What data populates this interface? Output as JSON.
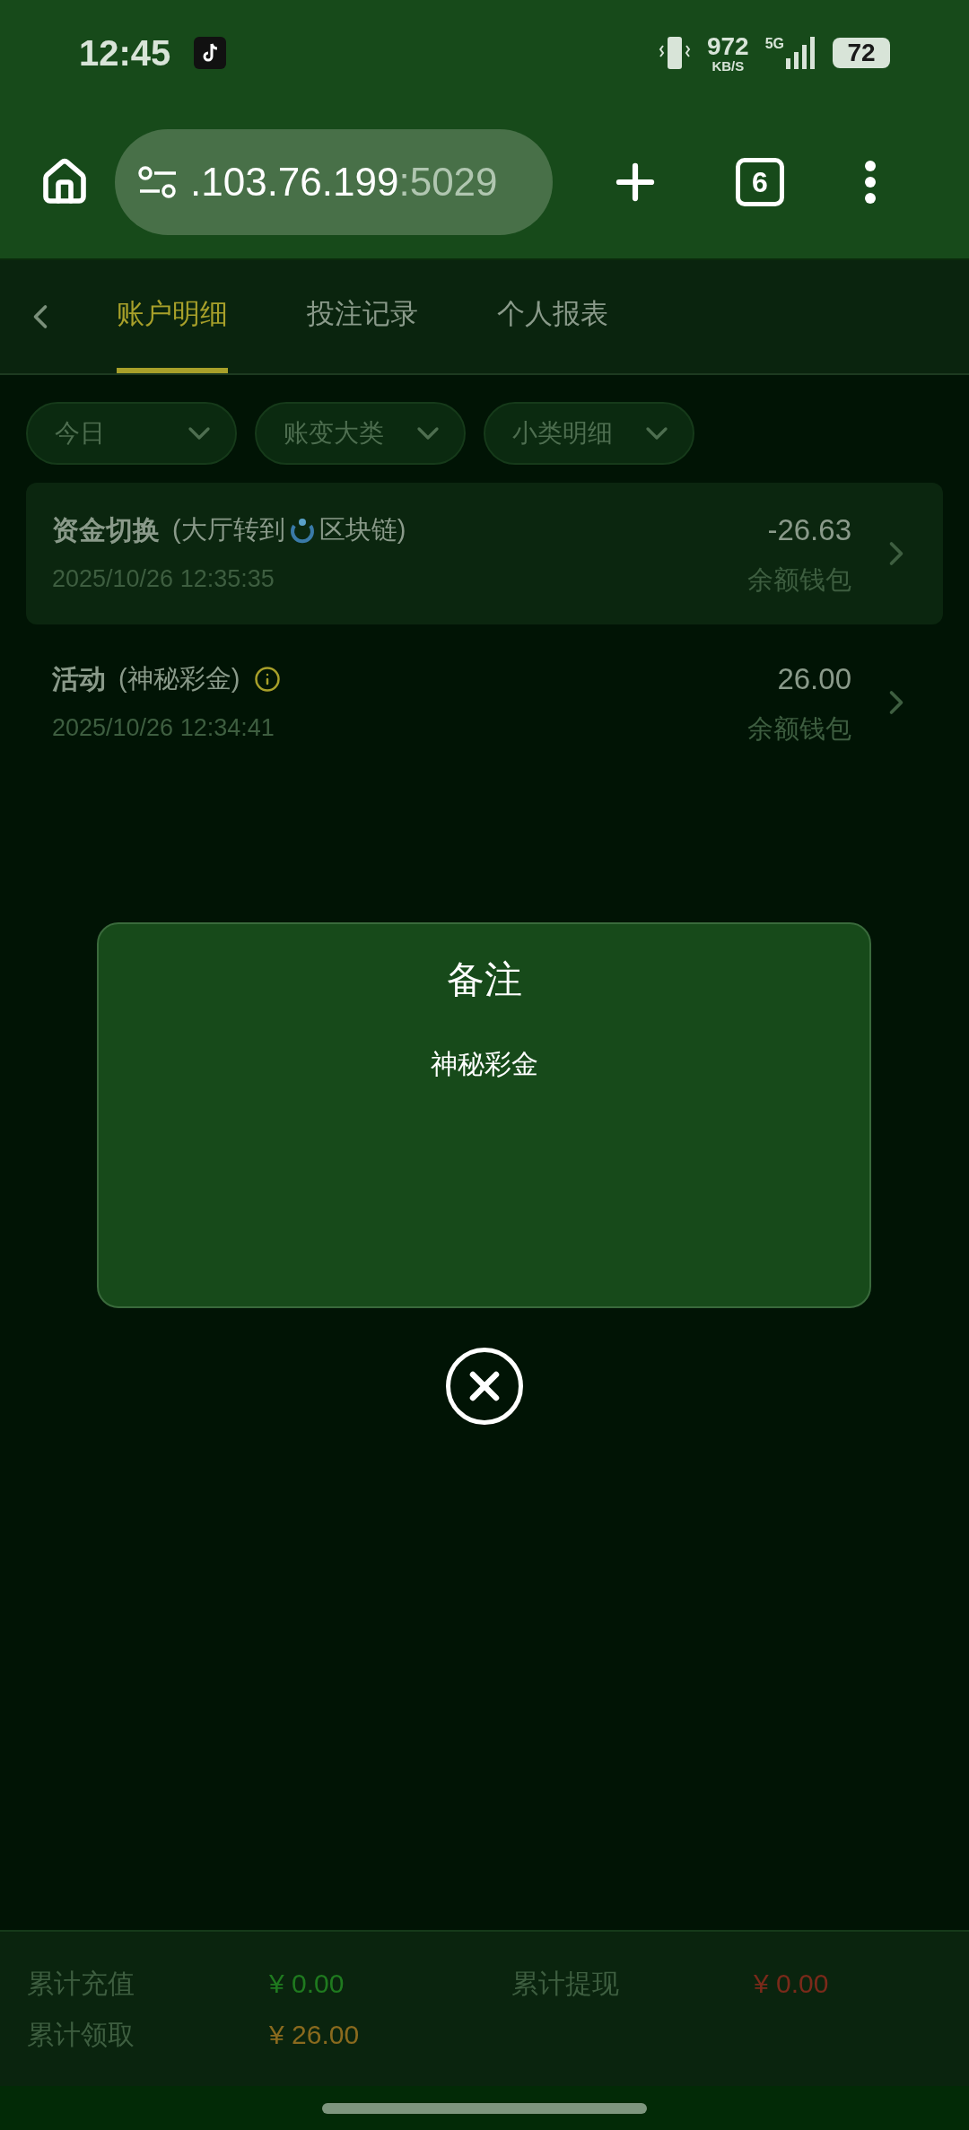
{
  "status_bar": {
    "time": "12:45",
    "speed": "972",
    "speed_unit": "KB/S",
    "network": "5G",
    "battery": "72"
  },
  "browser": {
    "url_host": ".103.76.199",
    "url_port": ":5029",
    "tab_count": "6"
  },
  "tabs": [
    {
      "label": "账户明细",
      "selected": true
    },
    {
      "label": "投注记录",
      "selected": false
    },
    {
      "label": "个人报表",
      "selected": false
    }
  ],
  "filters": [
    {
      "label": "今日"
    },
    {
      "label": "账变大类"
    },
    {
      "label": "小类明细"
    }
  ],
  "records": [
    {
      "kind": "transfer",
      "title": "资金切换",
      "detail_before": "(大厅转到",
      "detail_after": "区块链)",
      "time": "2025/10/26 12:35:35",
      "amount": "-26.63",
      "wallet": "余额钱包",
      "selected": true
    },
    {
      "kind": "activity",
      "title": "活动",
      "detail_before": "(神秘彩金)",
      "time": "2025/10/26 12:34:41",
      "amount": "26.00",
      "wallet": "余额钱包",
      "selected": false
    }
  ],
  "dialog": {
    "title": "备注",
    "content": "神秘彩金"
  },
  "totals": [
    {
      "label": "累计充值",
      "value": "¥ 0.00",
      "color": "#1f7a1f"
    },
    {
      "label": "累计提现",
      "value": "¥ 0.00",
      "color": "#7a2a1a"
    },
    {
      "label": "累计领取",
      "value": "¥ 26.00",
      "color": "#8a6a1e"
    }
  ]
}
